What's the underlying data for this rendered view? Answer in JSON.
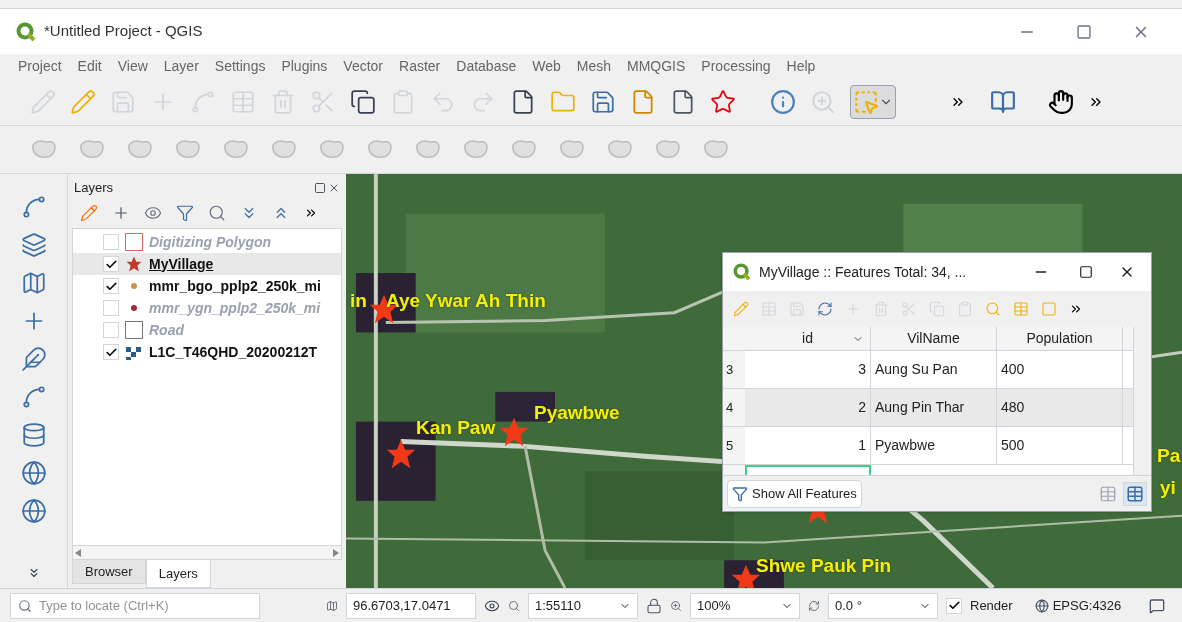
{
  "window": {
    "title": "*Untitled Project - QGIS"
  },
  "menu": [
    "Project",
    "Edit",
    "View",
    "Layer",
    "Settings",
    "Plugins",
    "Vector",
    "Raster",
    "Database",
    "Web",
    "Mesh",
    "MMQGIS",
    "Processing",
    "Help"
  ],
  "layers_panel": {
    "title": "Layers",
    "layers": [
      {
        "name": "Digitizing Polygon",
        "checked": false,
        "selected": false,
        "kind": "polygon",
        "color": "#e06666"
      },
      {
        "name": "MyVillage",
        "checked": true,
        "selected": true,
        "kind": "star",
        "color": "#c0392b"
      },
      {
        "name": "mmr_bgo_pplp2_250k_mi",
        "checked": true,
        "selected": false,
        "kind": "dot",
        "color": "#c8914e"
      },
      {
        "name": "mmr_ygn_pplp2_250k_mi",
        "checked": false,
        "selected": false,
        "kind": "dot",
        "color": "#a52a3a"
      },
      {
        "name": "Road",
        "checked": false,
        "selected": false,
        "kind": "polygon",
        "color": "#777777"
      },
      {
        "name": "L1C_T46QHD_20200212T",
        "checked": true,
        "selected": false,
        "kind": "raster",
        "color": "#2b5d8a"
      }
    ],
    "tabs": [
      {
        "label": "Browser",
        "selected": false
      },
      {
        "label": "Layers",
        "selected": true
      }
    ]
  },
  "map": {
    "labels": [
      "in",
      "Aye Ywar Ah Thin",
      "Kan Paw",
      "Pyawbwe",
      "Shwe Pauk Pin",
      "Pa",
      "yi"
    ]
  },
  "attribute_table": {
    "title": "MyVillage :: Features Total: 34, ...",
    "columns": [
      "id",
      "VilName",
      "Population"
    ],
    "rows": [
      {
        "row": "3",
        "id": "3",
        "name": "Aung Su Pan",
        "population": "400"
      },
      {
        "row": "4",
        "id": "2",
        "name": "Aung Pin Thar",
        "population": "480"
      },
      {
        "row": "5",
        "id": "1",
        "name": "Pyawbwe",
        "population": "500"
      }
    ],
    "filter_button": "Show All Features"
  },
  "status_bar": {
    "locate_placeholder": "Type to locate (Ctrl+K)",
    "coordinate": "96.6703,17.0471",
    "scale": "1:55110",
    "magnifier": "100%",
    "rotation": "0.0 °",
    "render": {
      "label": "Render",
      "checked": true
    },
    "crs": "EPSG:4326"
  }
}
